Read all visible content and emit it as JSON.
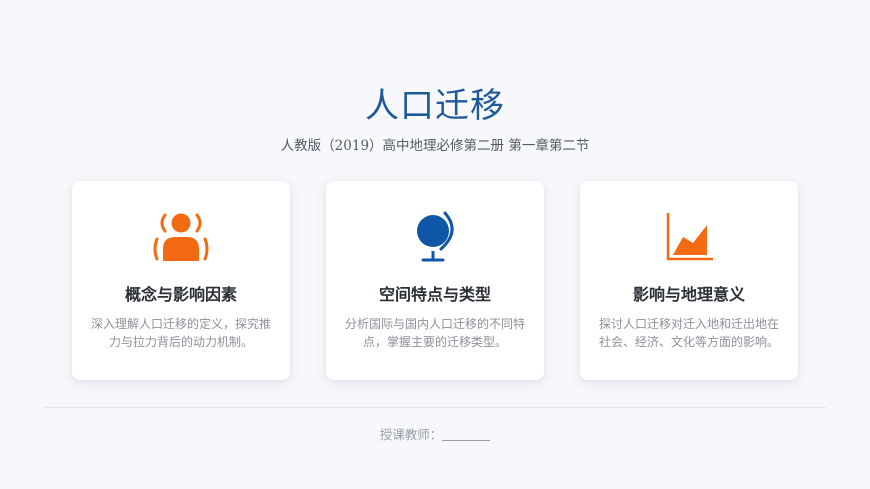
{
  "header": {
    "title": "人口迁移",
    "subtitle": "人教版（2019）高中地理必修第二册 第一章第二节"
  },
  "cards": [
    {
      "icon": "person-broadcast-icon",
      "title": "概念与影响因素",
      "description": "深入理解人口迁移的定义，探究推力与拉力背后的动力机制。"
    },
    {
      "icon": "globe-icon",
      "title": "空间特点与类型",
      "description": "分析国际与国内人口迁移的不同特点，掌握主要的迁移类型。"
    },
    {
      "icon": "area-chart-icon",
      "title": "影响与地理意义",
      "description": "探讨人口迁移对迁入地和迁出地在社会、经济、文化等方面的影响。"
    }
  ],
  "footer": {
    "teacher_label": "授课教师："
  },
  "colors": {
    "title": "#1f5a9a",
    "orange": "#f26b12",
    "blue": "#0f57a6"
  }
}
